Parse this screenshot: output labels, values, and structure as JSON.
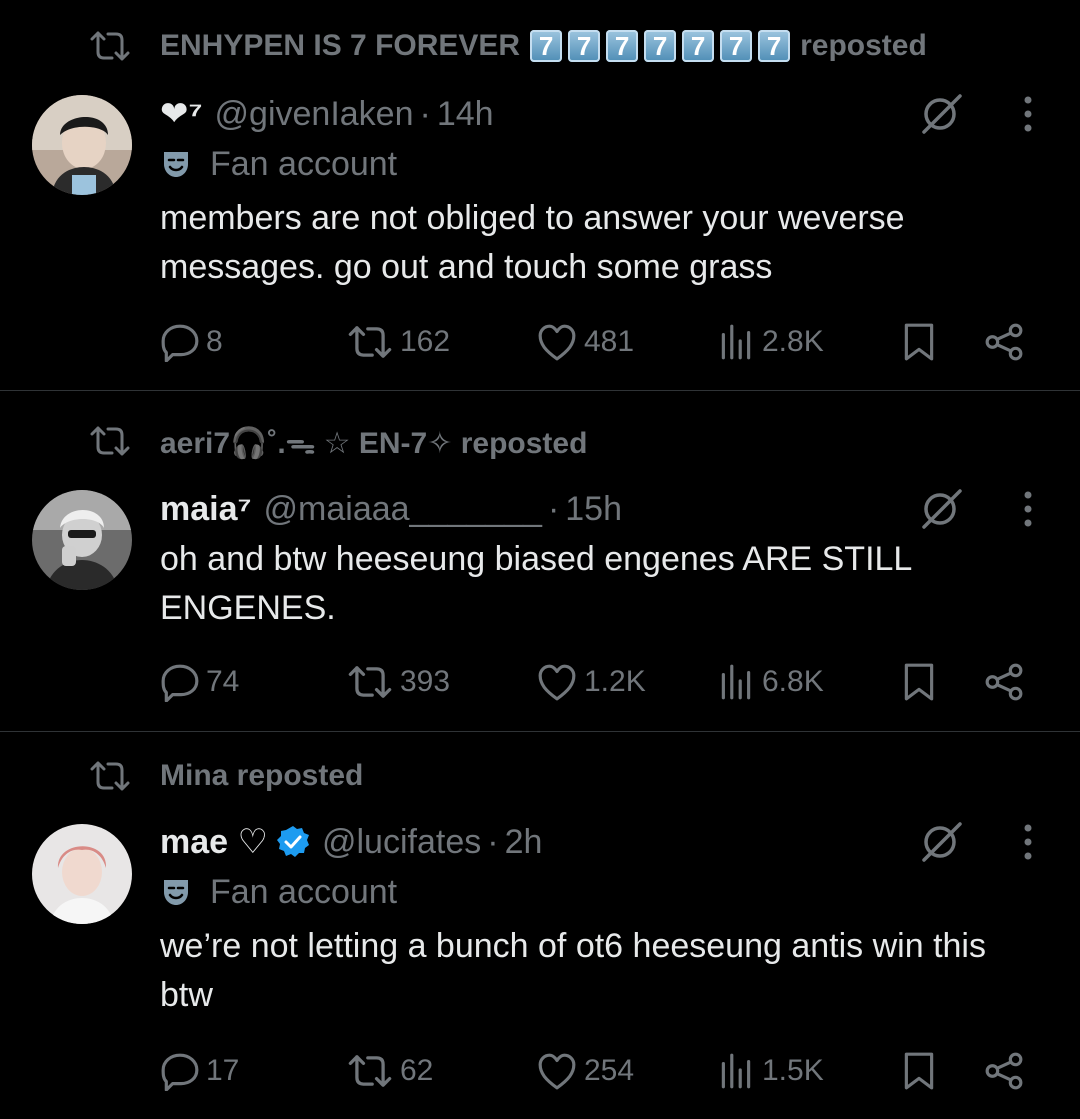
{
  "tweets": [
    {
      "repost_by": "ENHYPEN IS 7 FOREVER",
      "repost_badges": [
        "7",
        "7",
        "7",
        "7",
        "7",
        "7",
        "7"
      ],
      "repost_suffix": "reposted",
      "name": "❤⁷",
      "handle": "@givenIaken",
      "time": "14h",
      "label": "Fan account",
      "text": "members are not obliged to answer your weverse messages. go out and touch some grass",
      "stats": {
        "replies": "8",
        "reposts": "162",
        "likes": "481",
        "views": "2.8K"
      }
    },
    {
      "repost_by": "aeri7🎧˚.ᯓ ☆ EN-7✧ reposted",
      "name": "maia⁷",
      "handle": "@maiaaa_______",
      "time": "15h",
      "text": "oh and btw heeseung biased engenes ARE STILL ENGENES.",
      "stats": {
        "replies": "74",
        "reposts": "393",
        "likes": "1.2K",
        "views": "6.8K"
      }
    },
    {
      "repost_by": "Mina reposted",
      "name": "mae ♡",
      "handle": "@lucifates",
      "time": "2h",
      "label": "Fan account",
      "text": "we’re not letting a bunch of ot6 heeseung antis win this btw",
      "stats": {
        "replies": "17",
        "reposts": "62",
        "likes": "254",
        "views": "1.5K"
      }
    }
  ],
  "separator": "·",
  "colors": {
    "background": "#000000",
    "text": "#e7e9ea",
    "muted": "#71767b",
    "divider": "#2f3336",
    "verified": "#1d9bf0"
  }
}
